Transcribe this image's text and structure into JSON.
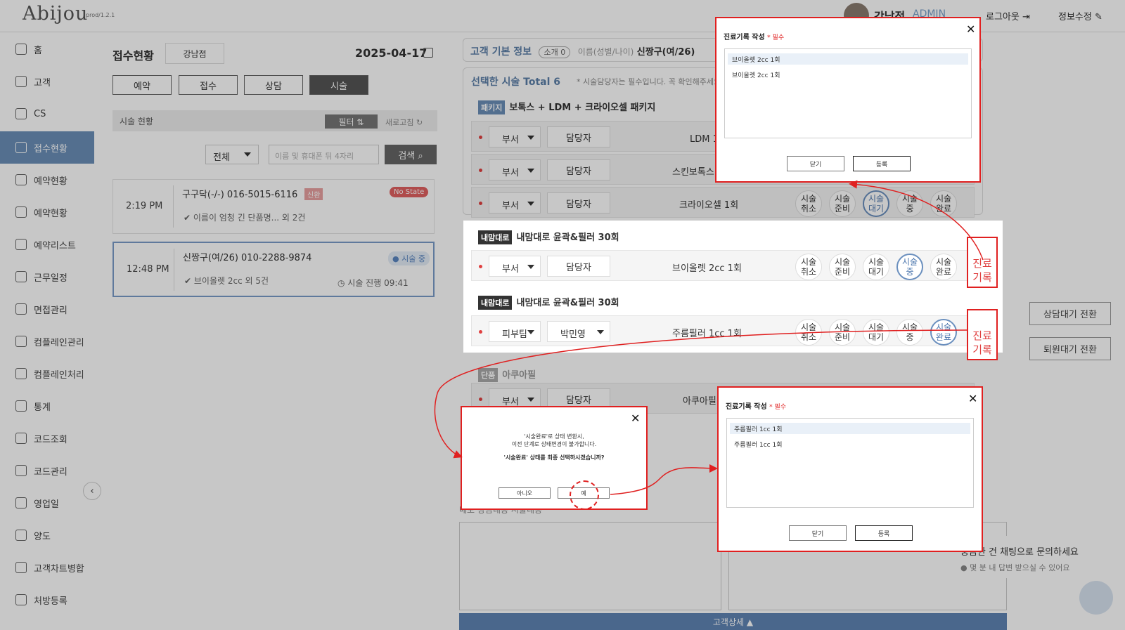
{
  "header": {
    "logo": "Abijou",
    "version": "prod/1.2.1",
    "user_name": "강남점",
    "user_role": "ADMIN",
    "logout": "로그아웃 ⇥",
    "profile_edit": "정보수정 ✎"
  },
  "sidebar": {
    "items": [
      {
        "label": "홈",
        "icon": "home-icon"
      },
      {
        "label": "고객",
        "icon": "users-icon"
      },
      {
        "label": "CS",
        "icon": "cs-icon"
      },
      {
        "label": "접수현황",
        "icon": "reception-icon",
        "active": true
      },
      {
        "label": "예약현황",
        "icon": "calendar-icon"
      },
      {
        "label": "예약현황",
        "icon": "calendar-icon"
      },
      {
        "label": "예약리스트",
        "icon": "list-icon"
      },
      {
        "label": "근무일정",
        "icon": "schedule-icon"
      },
      {
        "label": "면접관리",
        "icon": "interview-icon"
      },
      {
        "label": "컴플레인관리",
        "icon": "complaint-icon"
      },
      {
        "label": "컴플레인처리",
        "icon": "smile-icon"
      },
      {
        "label": "통계",
        "icon": "stats-icon"
      },
      {
        "label": "코드조회",
        "icon": "code-icon"
      },
      {
        "label": "코드관리",
        "icon": "code-icon"
      },
      {
        "label": "영업일",
        "icon": "calendar-icon"
      },
      {
        "label": "양도",
        "icon": "transfer-icon"
      },
      {
        "label": "고객차트병합",
        "icon": "merge-icon"
      },
      {
        "label": "처방등록",
        "icon": "prescription-icon"
      }
    ]
  },
  "left": {
    "title": "접수현황",
    "branch": "강남점",
    "date": "2025-04-17",
    "tabs": [
      "예약",
      "접수",
      "상담",
      "시술"
    ],
    "sub_title": "시술 현황",
    "filter": "필터 ⇅",
    "refresh": "새로고침 ↻",
    "select_all": "전체",
    "search_placeholder": "이름 및 휴대폰 뒤 4자리",
    "search_btn": "검색 ⌕",
    "cards": [
      {
        "time": "2:19 PM",
        "name": "구구닥(-/-)  016-5015-6116",
        "tag": "신환",
        "status": "No State",
        "desc": "✔ 이름이 엄청 긴 단품명... 외 2건"
      },
      {
        "time": "12:48 PM",
        "name": "신짱구(여/26)  010-2288-9874",
        "status": "● 시술 중",
        "desc": "✔ 브이올렛 2cc 외 5건",
        "progress": "◷ 시술 진행 09:41"
      }
    ]
  },
  "right": {
    "basic_info": "고객 기본 정보",
    "intro": "소개 0",
    "name_hint": "이름(성별/나이)",
    "customer": "신짱구(여/26)",
    "selected": "선택한 시술  Total 6",
    "required_note": "* 시술담당자는 필수입니다. 꼭 확인해주세요",
    "package1": {
      "tag": "패키지",
      "title": "보톡스 + LDM + 크라이오셀 패키지"
    },
    "rows_top": [
      {
        "dept": "부서",
        "staff": "담당자",
        "proc": "LDM 1회"
      },
      {
        "dept": "부서",
        "staff": "담당자",
        "proc": "스킨보톡스 4"
      },
      {
        "dept": "부서",
        "staff": "담당자",
        "proc": "크라이오셀 1회"
      }
    ],
    "pkgA": {
      "tag": "내맘대로",
      "title": "내맘대로 윤곽&필러 30회",
      "dept": "부서",
      "staff": "담당자",
      "proc": "브이올렛 2cc  1회"
    },
    "pkgB": {
      "tag": "내맘대로",
      "title": "내맘대로 윤곽&필러 30회",
      "dept": "피부팀",
      "staff": "박민영",
      "proc": "주름필러 1cc  1회"
    },
    "single": {
      "tag": "단품",
      "title": "아쿠아필",
      "dept": "부서",
      "staff": "담당자",
      "proc": "아쿠아필"
    },
    "status_labels": [
      "시술\n취소",
      "시술\n준비",
      "시술\n대기",
      "시술\n중",
      "시술\n완료"
    ],
    "record_label": "진료\n기록",
    "btn_consult": "상담대기 전환",
    "btn_exit": "퇴원대기 전환",
    "memo_tabs": "메모  상담내용  시술내용",
    "detail_bar": "고객상세 ▲",
    "chat_title": "궁금한 건 채팅으로 문의하세요",
    "chat_sub": "● 몇 분 내 답변 받으실 수 있어요"
  },
  "modal1": {
    "title": "진료기록 작성",
    "req": "* 필수",
    "sel": "브이올렛 2cc 1회",
    "opt": "브이올렛 2cc 1회",
    "close": "닫기",
    "submit": "등록"
  },
  "modal2": {
    "title": "진료기록 작성",
    "req": "* 필수",
    "sel": "주름필러 1cc 1회",
    "opt": "주름필러 1cc 1회",
    "close": "닫기",
    "submit": "등록"
  },
  "confirm": {
    "line1": "'시술완료'로 상태 변환시,",
    "line2": "이전 단계로 상태변경이 불가합니다.",
    "line3": "'시술완료' 상태를 최종 선택하시겠습니까?",
    "no": "아니오",
    "yes": "예"
  },
  "accent": "#6b8fb8",
  "highlight_red": "#e02020"
}
